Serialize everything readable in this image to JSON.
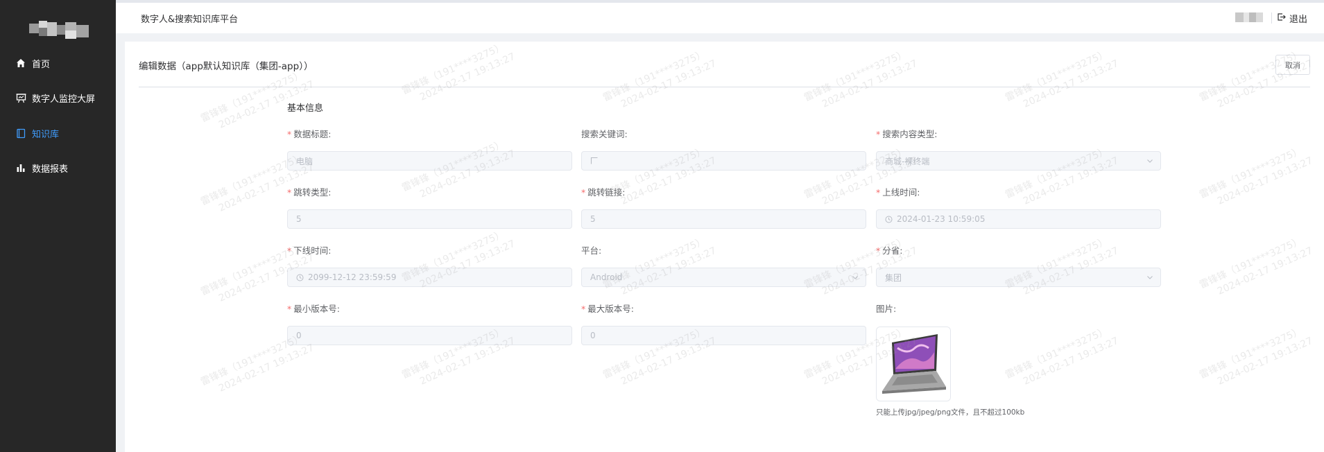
{
  "header": {
    "app_title": "数字人&搜索知识库平台",
    "logout_label": "退出"
  },
  "sidebar": {
    "items": [
      {
        "label": "首页",
        "icon": "home-icon"
      },
      {
        "label": "数字人监控大屏",
        "icon": "monitor-icon"
      },
      {
        "label": "知识库",
        "icon": "book-icon"
      },
      {
        "label": "数据报表",
        "icon": "bar-chart-icon"
      }
    ],
    "active_index": 2,
    "active_color": "#409eff",
    "background": "#272727"
  },
  "page": {
    "title": "编辑数据（app默认知识库（集团-app））",
    "cancel_label": "取消",
    "section_title": "基本信息"
  },
  "form": {
    "data_title": {
      "label": "数据标题:",
      "required": true,
      "value": "电脑"
    },
    "search_keyword": {
      "label": "搜索关键词:",
      "required": false,
      "value": ""
    },
    "search_content_type": {
      "label": "搜索内容类型:",
      "required": true,
      "value": "商城-裸终端"
    },
    "jump_type": {
      "label": "跳转类型:",
      "required": true,
      "value": "5"
    },
    "jump_link": {
      "label": "跳转链接:",
      "required": true,
      "value": "5"
    },
    "online_time": {
      "label": "上线时间:",
      "required": true,
      "value": "2024-01-23 10:59:05"
    },
    "offline_time": {
      "label": "下线时间:",
      "required": true,
      "value": "2099-12-12 23:59:59"
    },
    "platform": {
      "label": "平台:",
      "required": false,
      "value": "Android"
    },
    "province": {
      "label": "分省:",
      "required": true,
      "value": "集团"
    },
    "min_version": {
      "label": "最小版本号:",
      "required": true,
      "value": "0"
    },
    "max_version": {
      "label": "最大版本号:",
      "required": true,
      "value": "0"
    },
    "image": {
      "label": "图片:",
      "required": false,
      "tip": "只能上传jpg/jpeg/png文件，且不超过100kb"
    }
  },
  "watermark": {
    "line1": "雷锋锋（191****3275）",
    "line2": "2024-02-17 19:13:27"
  }
}
